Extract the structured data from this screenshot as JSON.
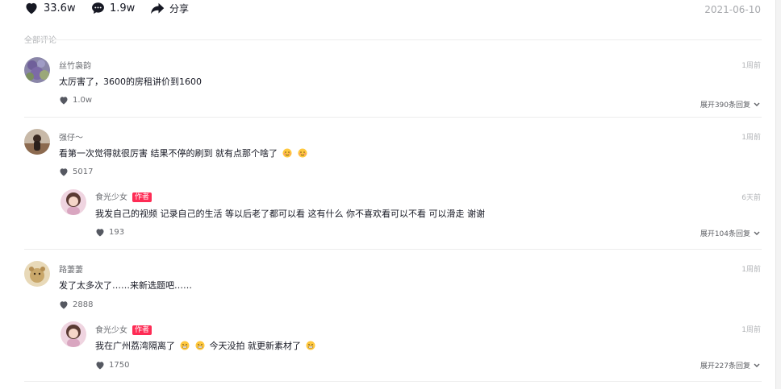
{
  "stats": {
    "likes": "33.6w",
    "comments": "1.9w",
    "share": "分享"
  },
  "date": "2021-06-10",
  "section_label": "全部评论",
  "comments": [
    {
      "user": "丝竹袅韵",
      "time": "1周前",
      "text": "太厉害了，3600的房租讲价到1600",
      "likes": "1.0w",
      "expand": "展开390条回复"
    },
    {
      "user": "强仔～",
      "time": "1周前",
      "text": "看第一次觉得就很厉害 结果不停的刷到 就有点那个啥了",
      "likes": "5017",
      "reply": {
        "user": "食光少女",
        "tag": "作者",
        "time": "6天前",
        "text": "我发自己的视频 记录自己的生活 等以后老了都可以看 这有什么 你不喜欢看可以不看 可以滑走 谢谢",
        "likes": "193",
        "expand": "展开104条回复"
      }
    },
    {
      "user": "路萋萋",
      "time": "1周前",
      "text": "发了太多次了……来新选题吧……",
      "likes": "2888",
      "reply": {
        "user": "食光少女",
        "tag": "作者",
        "time": "1周前",
        "text_a": "我在广州荔湾隔离了",
        "text_b": "今天没拍 就更新素材了",
        "likes": "1750",
        "expand": "展开227条回复"
      }
    }
  ],
  "colors": {
    "accent": "#fe2c55",
    "text": "#161823",
    "muted": "#b3b5b8"
  }
}
